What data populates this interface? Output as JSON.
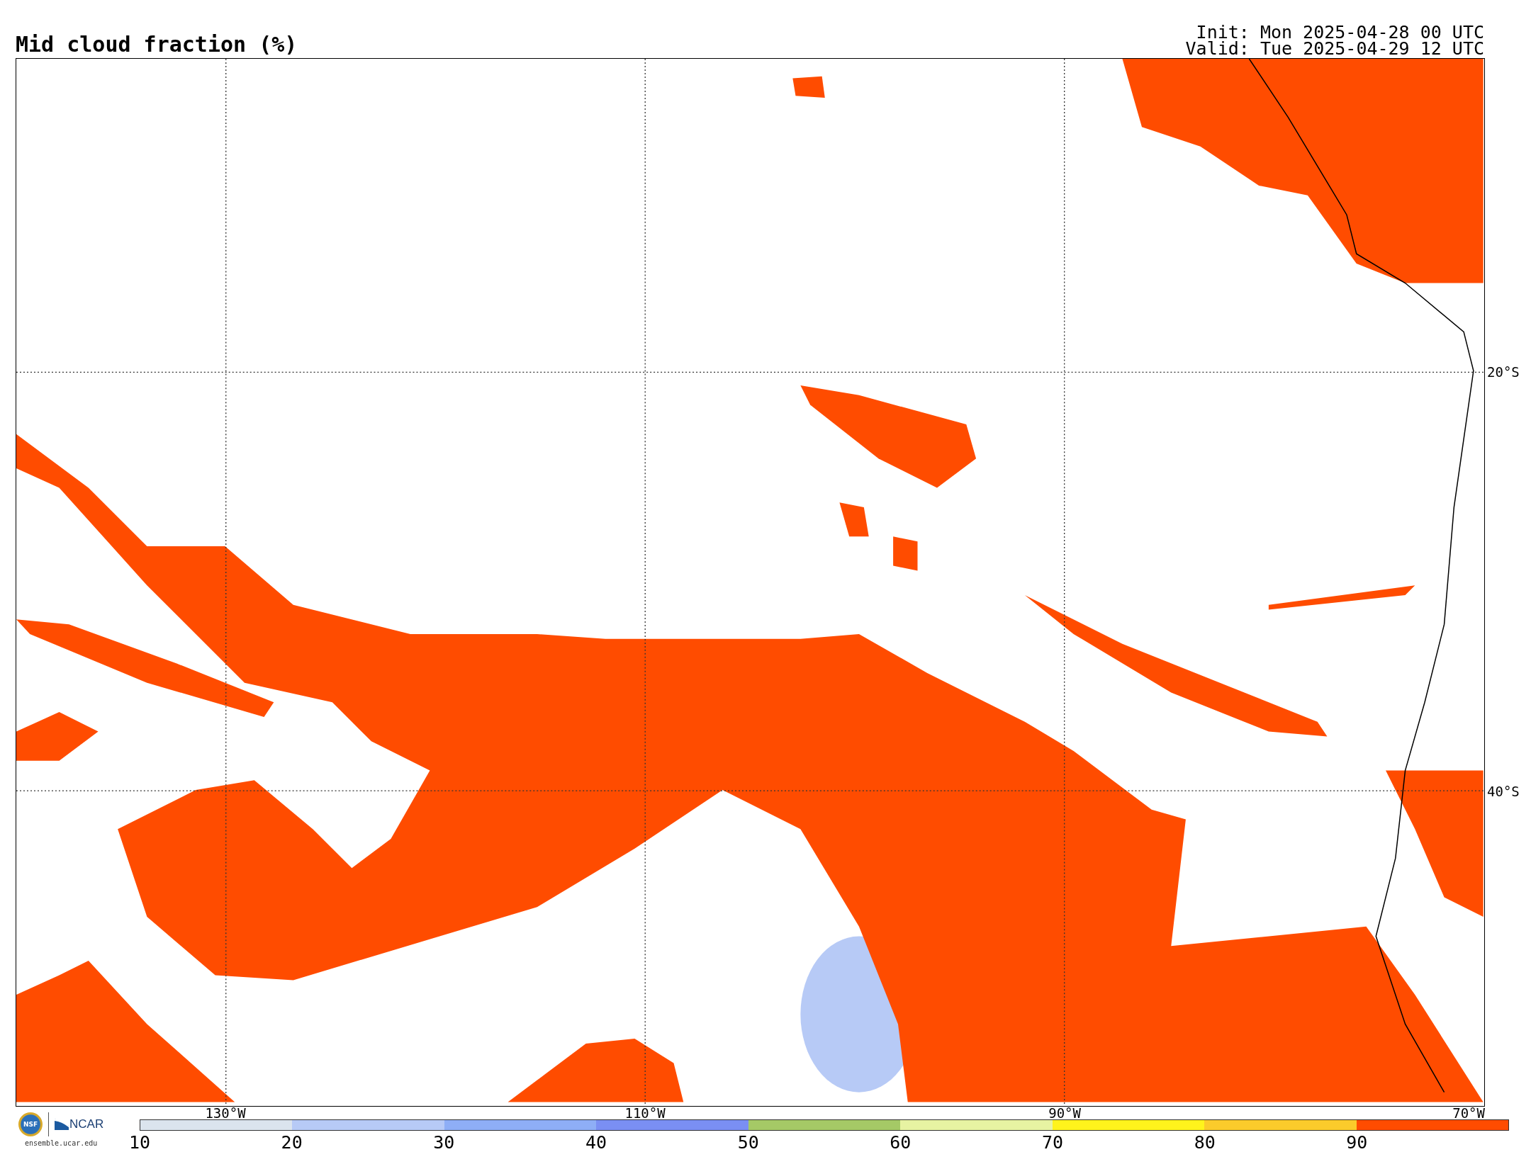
{
  "title": "Mid cloud fraction (%)",
  "init": "Init: Mon 2025-04-28 00 UTC",
  "valid": "Valid: Tue 2025-04-29 12 UTC",
  "map": {
    "kind": "map-picture"
  },
  "lat_labels": [
    "20°S",
    "40°S"
  ],
  "lon_labels": [
    "130°W",
    "110°W",
    "90°W",
    "70°W"
  ],
  "colorbar": {
    "segments": [
      {
        "label": "10",
        "color": "#dbe4ee"
      },
      {
        "label": "20",
        "color": "#b7caf6"
      },
      {
        "label": "30",
        "color": "#8eaef6"
      },
      {
        "label": "40",
        "color": "#7a8ff3"
      },
      {
        "label": "50",
        "color": "#a5c966"
      },
      {
        "label": "60",
        "color": "#e7f3a2"
      },
      {
        "label": "70",
        "color": "#fff31c"
      },
      {
        "label": "80",
        "color": "#fbcb2b"
      },
      {
        "label": "90",
        "color": "#ff4c00"
      }
    ]
  },
  "logos": {
    "nsf": "NSF",
    "ncar": "NCAR",
    "url": "ensemble.ucar.edu"
  }
}
